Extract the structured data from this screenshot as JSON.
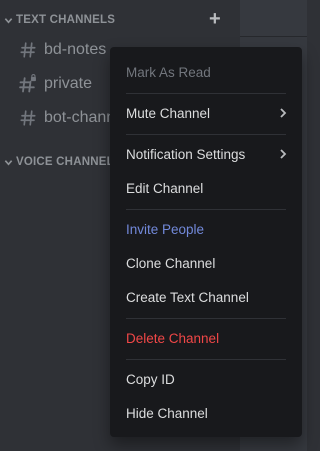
{
  "sidebar": {
    "text_category": "TEXT CHANNELS",
    "voice_category": "VOICE CHANNELS",
    "add_channel_glyph": "+",
    "channels": [
      {
        "name": "bd-notes",
        "icon": "hash-icon"
      },
      {
        "name": "private",
        "icon": "locked-hash-icon"
      },
      {
        "name": "bot-channel",
        "icon": "hash-icon"
      }
    ]
  },
  "context_menu": {
    "mark_as_read": "Mark As Read",
    "mute_channel": "Mute Channel",
    "notification_settings": "Notification Settings",
    "edit_channel": "Edit Channel",
    "invite_people": "Invite People",
    "clone_channel": "Clone Channel",
    "create_text_channel": "Create Text Channel",
    "delete_channel": "Delete Channel",
    "copy_id": "Copy ID",
    "hide_channel": "Hide Channel"
  },
  "colors": {
    "sidebar_bg": "#2f3136",
    "menu_bg": "#18191c",
    "text_muted": "#8e9297",
    "menu_text": "#dcddde",
    "disabled_text": "#72767d",
    "invite_blue": "#7289da",
    "danger_red": "#f04747"
  }
}
